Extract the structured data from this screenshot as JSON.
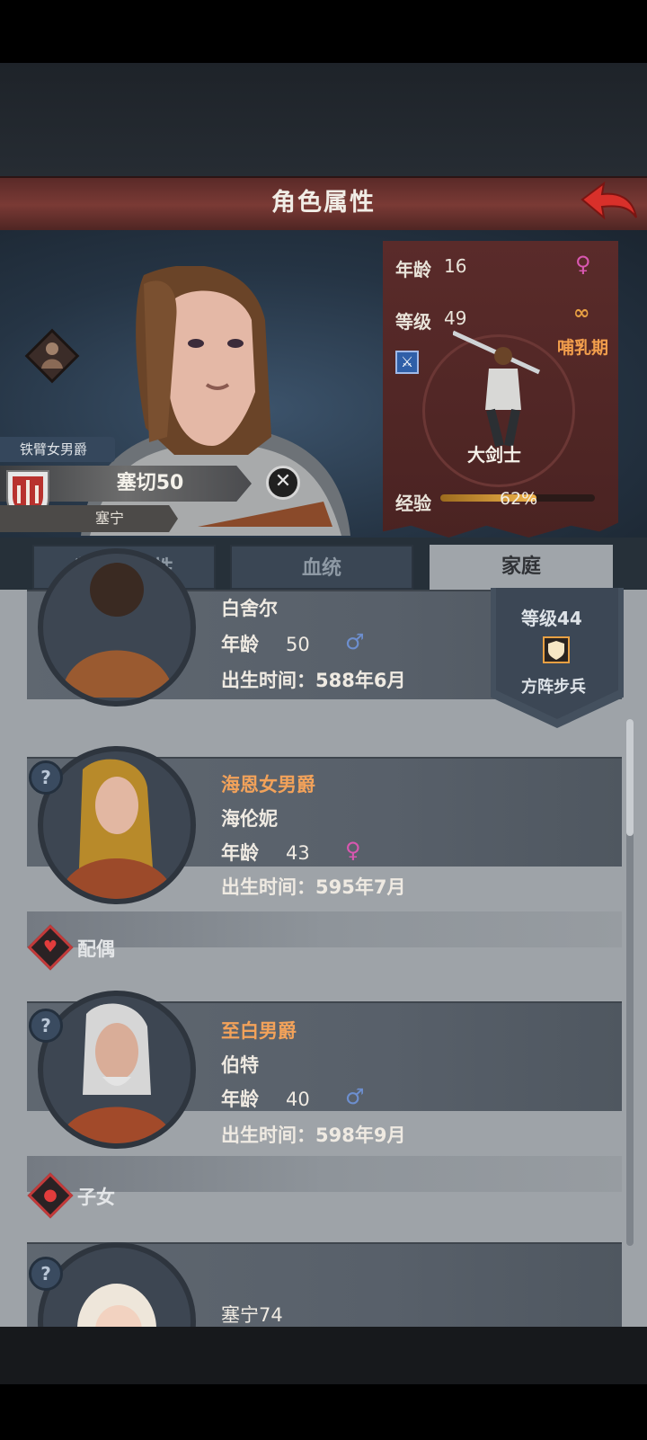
{
  "header": {
    "title": "角色属性"
  },
  "character": {
    "title": "铁臂女男爵",
    "name": "塞切50",
    "house": "塞宁",
    "close_symbol": "✕"
  },
  "stats": {
    "age_label": "年龄",
    "age_value": "16",
    "level_label": "等级",
    "level_value": "49",
    "status": "哺乳期",
    "class_name": "大剑士",
    "exp_label": "经验",
    "exp_value": "62%",
    "exp_fraction": 0.62,
    "gender_symbol": "♀",
    "ring_symbol": "∞",
    "sword_symbol": "⚔"
  },
  "tabs": [
    {
      "label": "装备和属性",
      "active": false
    },
    {
      "label": "血统",
      "active": false
    },
    {
      "label": "家庭",
      "active": true
    }
  ],
  "family": {
    "father": {
      "name": "白舍尔",
      "age_label": "年龄",
      "age": "50",
      "gender_symbol": "♂",
      "birth": "出生时间：588年6月",
      "rank_level": "等级44",
      "rank_class": "方阵步兵"
    },
    "mother": {
      "title": "海恩女男爵",
      "name": "海伦妮",
      "age_label": "年龄",
      "age": "43",
      "gender_symbol": "♀",
      "birth": "出生时间：595年7月"
    },
    "spouse_section": "配偶",
    "spouse": {
      "title": "至白男爵",
      "name": "伯特",
      "age_label": "年龄",
      "age": "40",
      "gender_symbol": "♂",
      "birth": "出生时间：598年9月"
    },
    "children_section": "子女",
    "child": {
      "name": "塞宁74"
    },
    "unknown_symbol": "?"
  },
  "colors": {
    "accent": "#f29e4c",
    "header": "#6b302d",
    "male": "#6d8fcf",
    "female": "#d957b0"
  }
}
